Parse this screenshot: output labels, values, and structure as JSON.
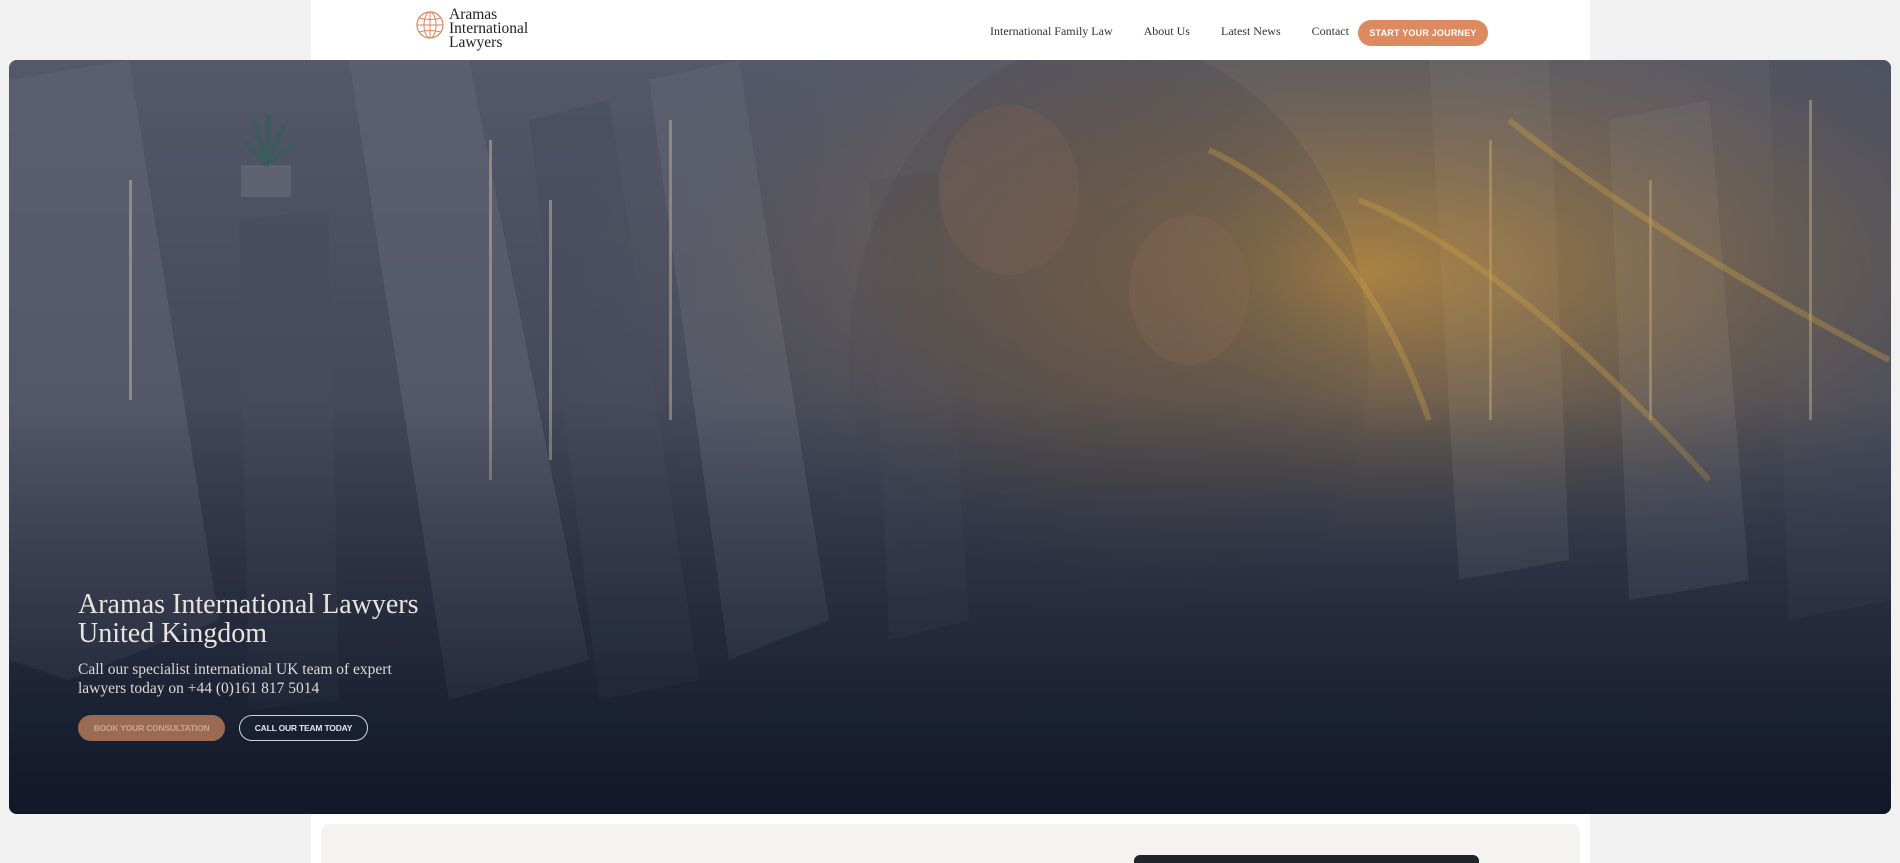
{
  "header": {
    "logo": {
      "line1": "Aramas",
      "line2": "International",
      "line3": "Lawyers",
      "icon": "globe-icon"
    },
    "nav": [
      {
        "label": "International Family Law"
      },
      {
        "label": "About Us"
      },
      {
        "label": "Latest News"
      },
      {
        "label": "Contact"
      }
    ],
    "cta_label": "START YOUR JOURNEY"
  },
  "hero": {
    "title_line1": "Aramas International Lawyers",
    "title_line2": "United Kingdom",
    "subtitle": "Call our specialist international UK team of expert lawyers today on +44 (0)161 817 5014",
    "primary_button": "BOOK YOUR CONSULTATION",
    "secondary_button": "CALL OUR TEAM TODAY"
  },
  "colors": {
    "accent": "#dc8a60",
    "hero_overlay": "#141a2a",
    "dark_panel": "#20242d"
  }
}
